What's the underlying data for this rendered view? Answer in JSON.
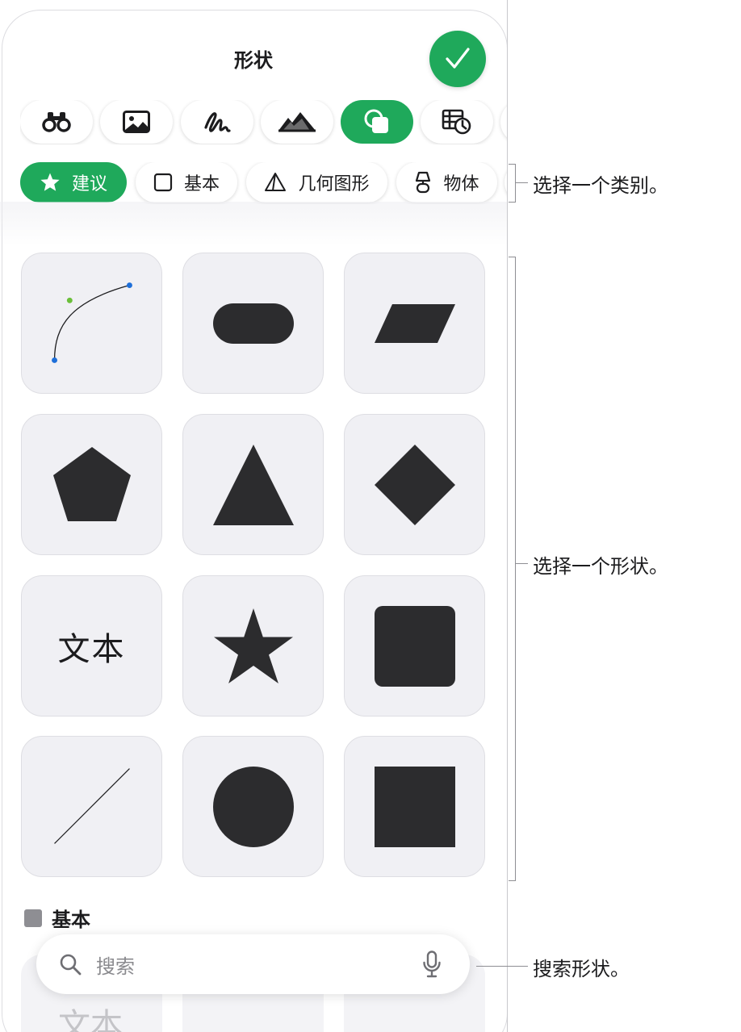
{
  "header": {
    "title": "形状",
    "done_icon": "checkmark-icon"
  },
  "tabs": [
    {
      "icon": "binoculars-icon"
    },
    {
      "icon": "photo-icon"
    },
    {
      "icon": "scribble-icon"
    },
    {
      "icon": "mountains-icon"
    },
    {
      "icon": "shapes-icon",
      "active": true
    },
    {
      "icon": "table-chart-icon"
    }
  ],
  "categories": [
    {
      "label": "建议",
      "icon": "star-icon",
      "active": true
    },
    {
      "label": "基本",
      "icon": "square-icon"
    },
    {
      "label": "几何图形",
      "icon": "pyramid-icon"
    },
    {
      "label": "物体",
      "icon": "lamp-icon"
    }
  ],
  "shapes": [
    {
      "name": "curve"
    },
    {
      "name": "rounded-pill"
    },
    {
      "name": "parallelogram"
    },
    {
      "name": "pentagon"
    },
    {
      "name": "triangle"
    },
    {
      "name": "diamond"
    },
    {
      "name": "text",
      "label": "文本"
    },
    {
      "name": "star"
    },
    {
      "name": "rounded-square"
    },
    {
      "name": "line"
    },
    {
      "name": "circle"
    },
    {
      "name": "square"
    }
  ],
  "section": {
    "label": "基本"
  },
  "ghost_text": "文本",
  "search": {
    "placeholder": "搜索",
    "icon": "magnifier-icon",
    "mic_icon": "microphone-icon"
  },
  "callouts": {
    "category": "选择一个类别。",
    "shape": "选择一个形状。",
    "search": "搜索形状。"
  },
  "colors": {
    "accent": "#1fa95b",
    "shape_fill": "#2c2c2e",
    "tile_bg": "#f0f0f4"
  }
}
